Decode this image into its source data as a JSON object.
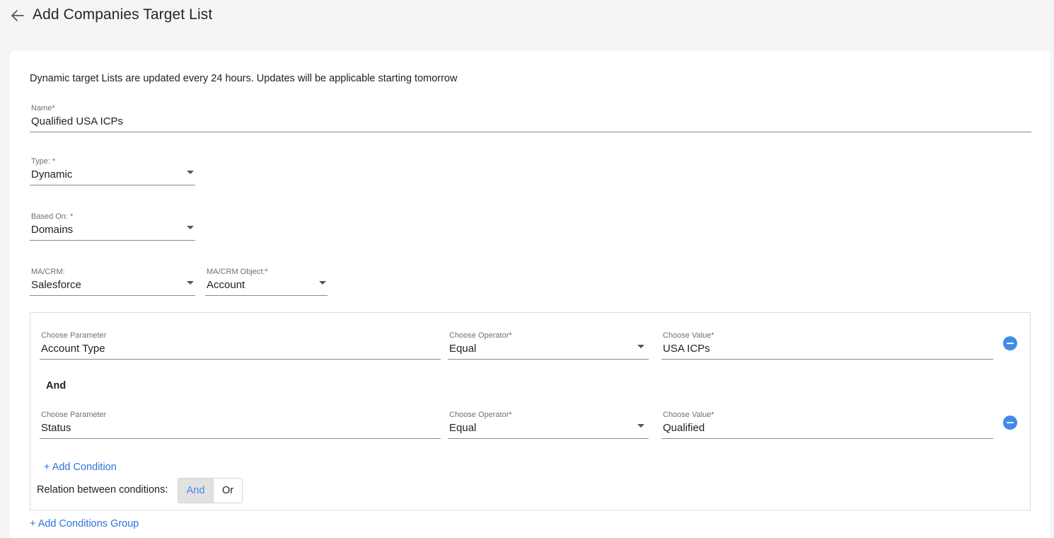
{
  "header": {
    "title": "Add Companies Target List",
    "back_icon": "arrow-left-icon"
  },
  "info": "Dynamic target Lists are updated every 24 hours. Updates will be applicable starting tomorrow",
  "form": {
    "name": {
      "label": "Name*",
      "value": "Qualified USA ICPs"
    },
    "type": {
      "label": "Type: *",
      "value": "Dynamic"
    },
    "based_on": {
      "label": "Based On: *",
      "value": "Domains"
    },
    "crm": {
      "label": "MA/CRM:",
      "value": "Salesforce"
    },
    "crm_object": {
      "label": "MA/CRM Object:*",
      "value": "Account"
    }
  },
  "conditions_group": {
    "conditions": [
      {
        "parameter_label": "Choose Parameter",
        "parameter_value": "Account Type",
        "operator_label": "Choose Operator*",
        "operator_value": "Equal",
        "value_label": "Choose Value*",
        "value": "USA ICPs"
      },
      {
        "parameter_label": "Choose Parameter",
        "parameter_value": "Status",
        "operator_label": "Choose Operator*",
        "operator_value": "Equal",
        "value_label": "Choose Value*",
        "value": "Qualified"
      }
    ],
    "joiner": "And",
    "add_condition": "+ Add Condition",
    "relation_label": "Relation between conditions:",
    "relation_options": [
      "And",
      "Or"
    ],
    "relation_selected": "And"
  },
  "add_group": "+ Add Conditions Group",
  "colors": {
    "accent": "#3f8ce8",
    "link": "#2e73d6",
    "background": "#f4f5f4"
  }
}
